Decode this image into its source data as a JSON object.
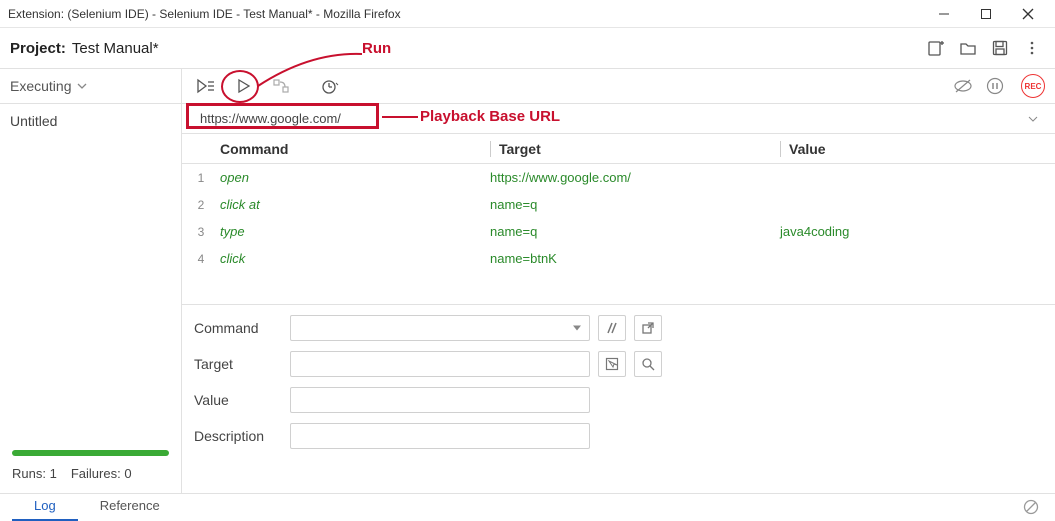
{
  "window": {
    "title": "Extension: (Selenium IDE) - Selenium IDE - Test Manual* - Mozilla Firefox"
  },
  "project": {
    "label": "Project:",
    "name": "Test Manual*"
  },
  "sidebar": {
    "mode_label": "Executing",
    "test_name": "Untitled",
    "runs_label": "Runs:",
    "runs_value": "1",
    "failures_label": "Failures:",
    "failures_value": "0"
  },
  "url_bar": {
    "value": "https://www.google.com/"
  },
  "table": {
    "headers": {
      "command": "Command",
      "target": "Target",
      "value": "Value"
    },
    "rows": [
      {
        "n": "1",
        "command": "open",
        "target": "https://www.google.com/",
        "value": ""
      },
      {
        "n": "2",
        "command": "click at",
        "target": "name=q",
        "value": ""
      },
      {
        "n": "3",
        "command": "type",
        "target": "name=q",
        "value": "java4coding"
      },
      {
        "n": "4",
        "command": "click",
        "target": "name=btnK",
        "value": ""
      }
    ]
  },
  "editor": {
    "command_label": "Command",
    "target_label": "Target",
    "value_label": "Value",
    "description_label": "Description"
  },
  "tabs": {
    "log": "Log",
    "reference": "Reference"
  },
  "record_label": "REC",
  "annotations": {
    "run": "Run",
    "playback_url": "Playback Base URL"
  }
}
